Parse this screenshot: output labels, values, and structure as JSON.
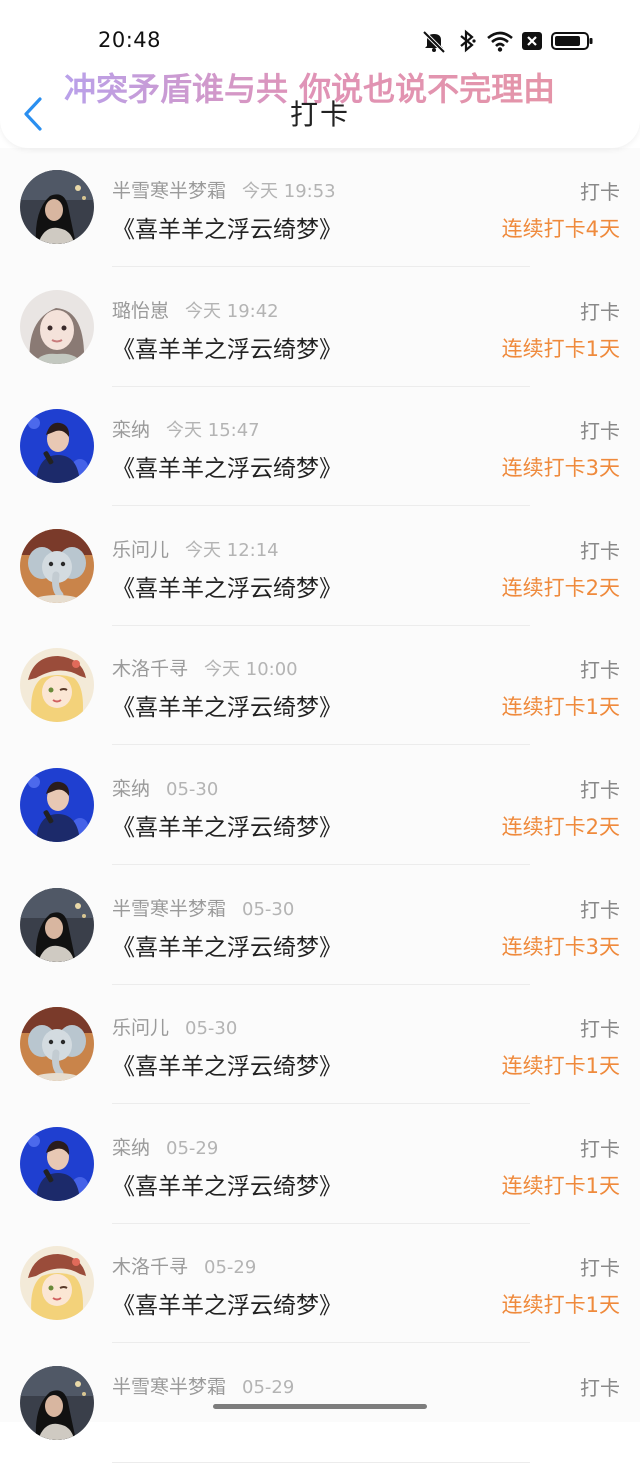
{
  "status_bar": {
    "time": "20:48"
  },
  "overlay_caption": "冲突矛盾谁与共 你说也说不完理由",
  "header": {
    "title": "打卡"
  },
  "colors": {
    "accent_orange": "#ef8a3c",
    "back_blue": "#2a8ff0",
    "muted_text": "#9a9a9a"
  },
  "items": [
    {
      "name": "半雪寒半梦霜",
      "date": "今天 19:53",
      "book": "《喜羊羊之浮云绮梦》",
      "action": "打卡",
      "streak": "连续打卡4天",
      "avatar": "night-portrait-avatar"
    },
    {
      "name": "璐怡崽",
      "date": "今天 19:42",
      "book": "《喜羊羊之浮云绮梦》",
      "action": "打卡",
      "streak": "连续打卡1天",
      "avatar": "girl-portrait-avatar"
    },
    {
      "name": "栾纳",
      "date": "今天 15:47",
      "book": "《喜羊羊之浮云绮梦》",
      "action": "打卡",
      "streak": "连续打卡3天",
      "avatar": "singer-blue-avatar"
    },
    {
      "name": "乐问儿",
      "date": "今天 12:14",
      "book": "《喜羊羊之浮云绮梦》",
      "action": "打卡",
      "streak": "连续打卡2天",
      "avatar": "elephant-avatar"
    },
    {
      "name": "木洛千寻",
      "date": "今天 10:00",
      "book": "《喜羊羊之浮云绮梦》",
      "action": "打卡",
      "streak": "连续打卡1天",
      "avatar": "anime-girl-avatar"
    },
    {
      "name": "栾纳",
      "date": "05-30",
      "book": "《喜羊羊之浮云绮梦》",
      "action": "打卡",
      "streak": "连续打卡2天",
      "avatar": "singer-blue-avatar"
    },
    {
      "name": "半雪寒半梦霜",
      "date": "05-30",
      "book": "《喜羊羊之浮云绮梦》",
      "action": "打卡",
      "streak": "连续打卡3天",
      "avatar": "night-portrait-avatar"
    },
    {
      "name": "乐问儿",
      "date": "05-30",
      "book": "《喜羊羊之浮云绮梦》",
      "action": "打卡",
      "streak": "连续打卡1天",
      "avatar": "elephant-avatar"
    },
    {
      "name": "栾纳",
      "date": "05-29",
      "book": "《喜羊羊之浮云绮梦》",
      "action": "打卡",
      "streak": "连续打卡1天",
      "avatar": "singer-blue-avatar"
    },
    {
      "name": "木洛千寻",
      "date": "05-29",
      "book": "《喜羊羊之浮云绮梦》",
      "action": "打卡",
      "streak": "连续打卡1天",
      "avatar": "anime-girl-avatar"
    },
    {
      "name": "半雪寒半梦霜",
      "date": "05-29",
      "book": "",
      "action": "打卡",
      "streak": "",
      "avatar": "night-portrait-avatar"
    }
  ]
}
